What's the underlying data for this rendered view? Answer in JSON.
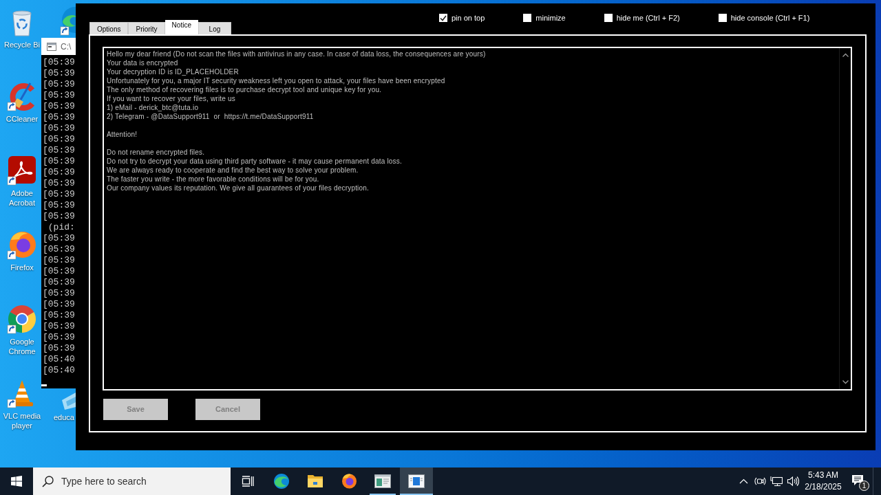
{
  "desktop": {
    "icons": [
      {
        "kind": "recycle-bin",
        "label": "Recycle Bi",
        "shortcut": false
      },
      {
        "kind": "ccleaner",
        "label": "CCleaner",
        "shortcut": true
      },
      {
        "kind": "acrobat",
        "label": "Adobe Acrobat",
        "shortcut": true
      },
      {
        "kind": "firefox",
        "label": "Firefox",
        "shortcut": true
      },
      {
        "kind": "chrome",
        "label": "Google Chrome",
        "shortcut": true
      },
      {
        "kind": "vlc",
        "label": "VLC media player",
        "shortcut": true
      }
    ],
    "column_2": [
      {
        "kind": "edge",
        "shortcut": true
      },
      {
        "kind": "education",
        "label": "educa"
      }
    ]
  },
  "console_window": {
    "title": "C:\\",
    "lines": [
      "[05:39",
      "[05:39",
      "[05:39",
      "[05:39",
      "[05:39",
      "[05:39",
      "[05:39",
      "[05:39",
      "[05:39",
      "[05:39",
      "[05:39",
      "[05:39",
      "[05:39",
      "[05:39",
      "[05:39",
      " (pid:",
      "[05:39",
      "[05:39",
      "[05:39",
      "[05:39",
      "[05:39",
      "[05:39",
      "[05:39",
      "[05:39",
      "[05:39",
      "[05:39",
      "[05:39",
      "[05:40",
      "[05:40"
    ]
  },
  "app_window": {
    "tabs": [
      {
        "label": "Options",
        "selected": false
      },
      {
        "label": "Priority",
        "selected": false
      },
      {
        "label": "Notice",
        "selected": true
      },
      {
        "label": "Log",
        "selected": false
      }
    ],
    "options": [
      {
        "label": "pin on top",
        "checked": true
      },
      {
        "label": "minimize",
        "checked": false
      },
      {
        "label": "hide me (Ctrl + F2)",
        "checked": false
      },
      {
        "label": "hide console (Ctrl + F1)",
        "checked": false
      }
    ],
    "notice": [
      [
        "Hello my dear friend (Do not scan the files with antivirus in any case. In case of data loss, the consequences are yours)",
        "Your data is encrypted",
        "Your decryption ID is ID_PLACEHOLDER",
        "Unfortunately for you, a major IT security weakness left you open to attack, your files have been encrypted",
        "The only method of recovering files is to purchase decrypt tool and unique key for you.",
        "If you want to recover your files, write us",
        "1) eMail - derick_btc@tuta.io",
        "2) Telegram - @DataSupport911  or  https://t.me/DataSupport911"
      ],
      [
        "Attention!"
      ],
      [
        "Do not rename encrypted files.",
        "Do not try to decrypt your data using third party software - it may cause permanent data loss.",
        "We are always ready to cooperate and find the best way to solve your problem.",
        "The faster you write - the more favorable conditions will be for you.",
        "Our company values its reputation. We give all guarantees of your files decryption."
      ]
    ],
    "buttons": [
      {
        "label": "Save",
        "disabled": true
      },
      {
        "label": "Cancel",
        "disabled": true
      }
    ]
  },
  "taskbar": {
    "search": {
      "placeholder": "Type here to search"
    },
    "apps": [
      {
        "kind": "edge",
        "running": false,
        "selected": false
      },
      {
        "kind": "explorer",
        "running": false,
        "selected": false
      },
      {
        "kind": "firefox",
        "running": false,
        "selected": false
      },
      {
        "kind": "form-window",
        "running": true,
        "selected": false
      },
      {
        "kind": "panel-window",
        "running": true,
        "selected": true
      }
    ],
    "clock": {
      "time": "5:43 AM",
      "date": "2/18/2025"
    },
    "notifications": {
      "count": "1"
    }
  }
}
